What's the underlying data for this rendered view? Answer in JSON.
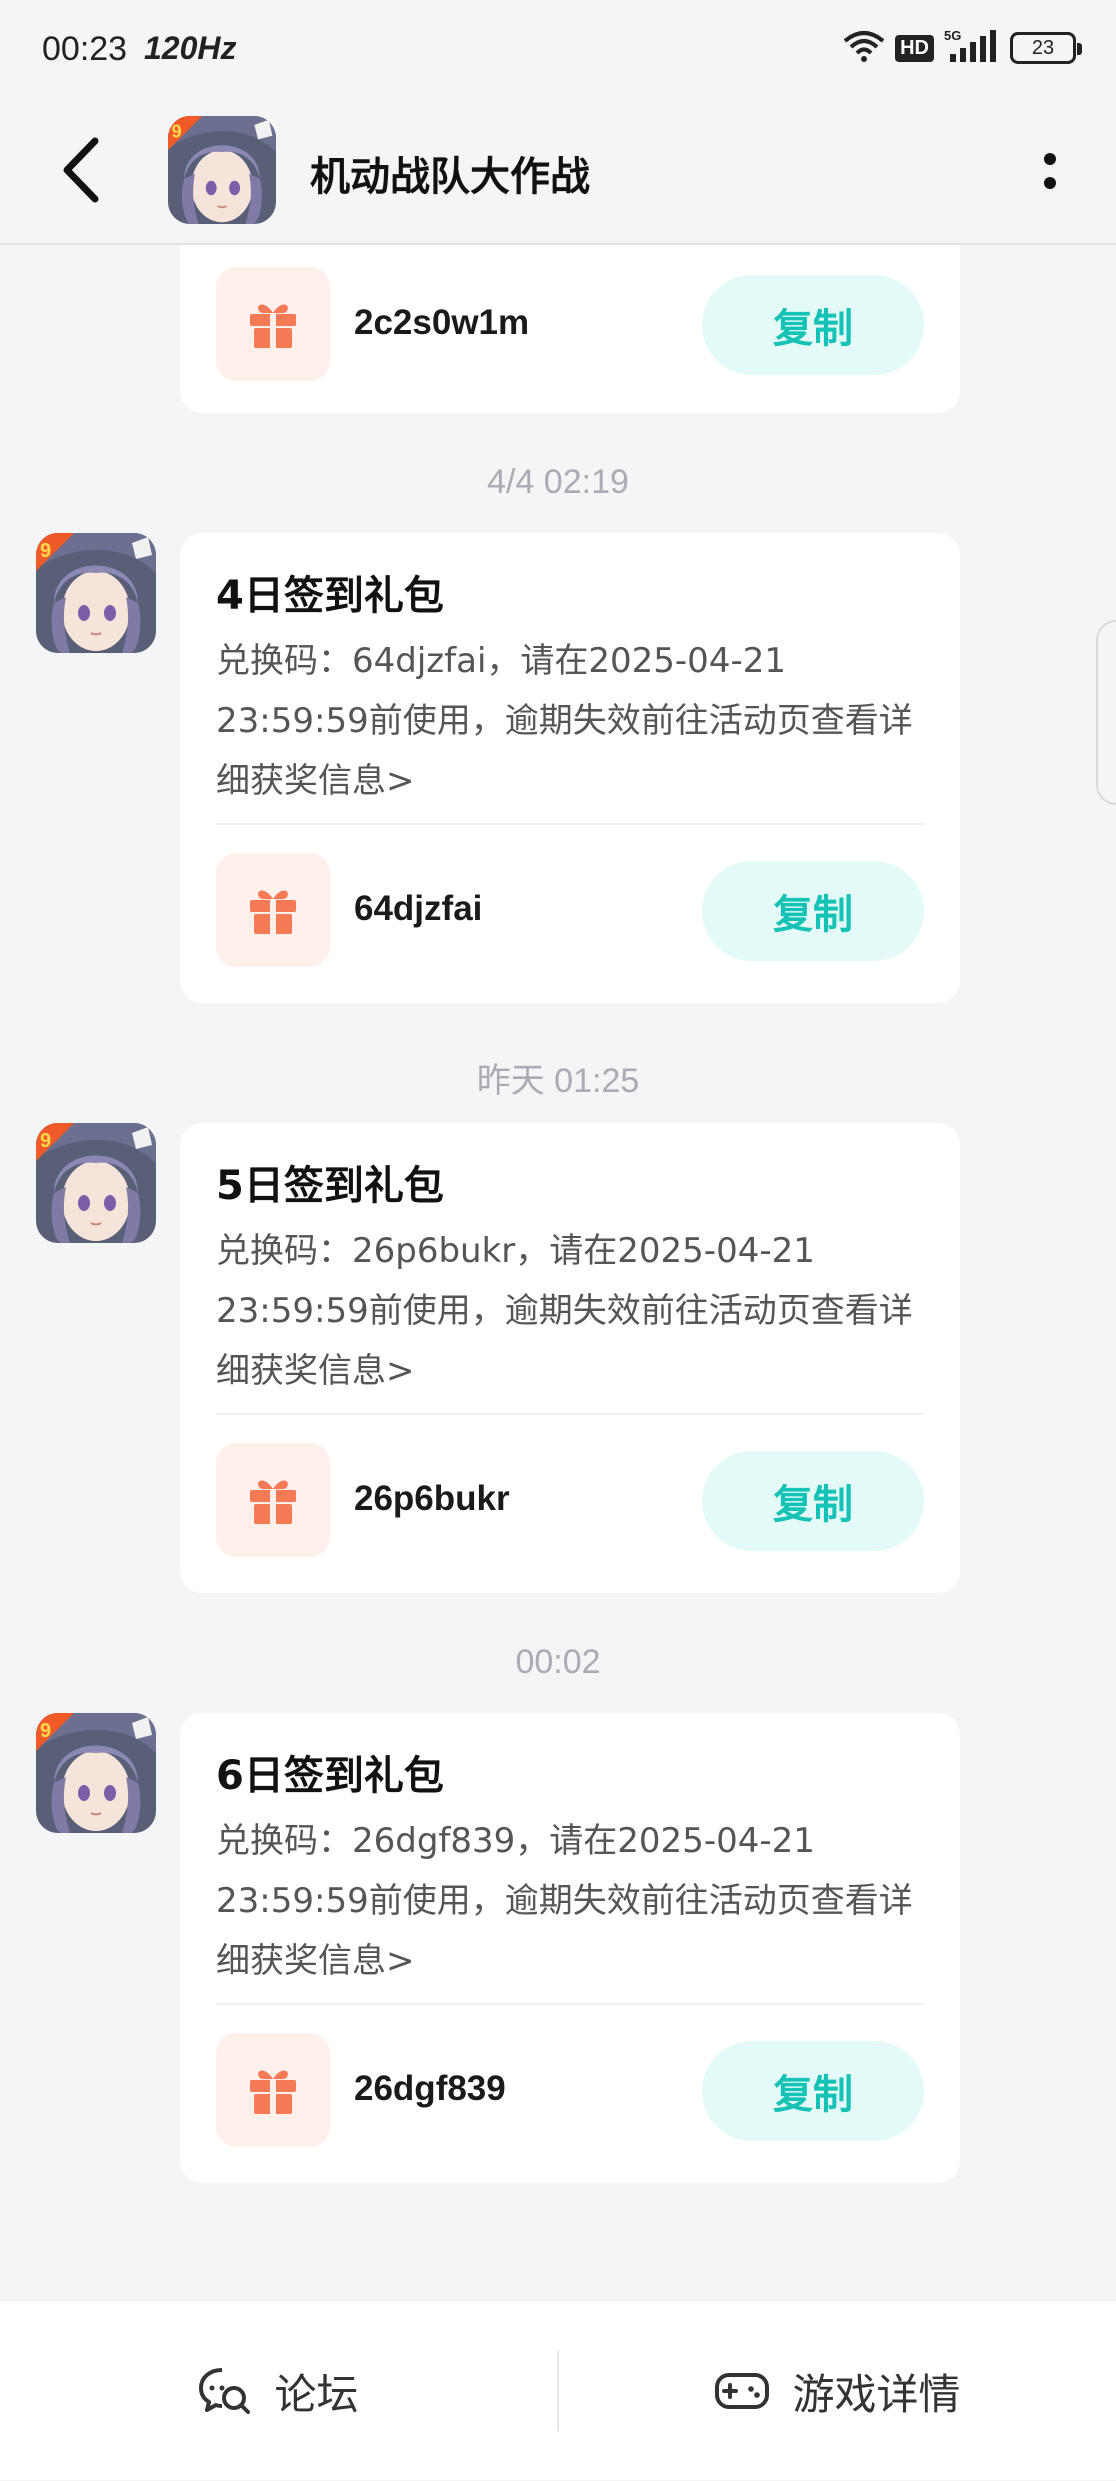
{
  "status_bar": {
    "time": "00:23",
    "refresh_rate": "120Hz",
    "hd": "HD",
    "network": "5G",
    "battery": "23"
  },
  "header": {
    "title": "机动战队大作战"
  },
  "messages": [
    {
      "code": "2c2s0w1m",
      "copy_label": "复制"
    },
    {
      "timestamp": "4/4  02:19",
      "title": "4日签到礼包",
      "description": "兑换码：64djzfai，请在2025-04-21 23:59:59前使用，逾期失效前往活动页查看详细获奖信息>",
      "code": "64djzfai",
      "copy_label": "复制"
    },
    {
      "timestamp": "昨天  01:25",
      "title": "5日签到礼包",
      "description": "兑换码：26p6bukr，请在2025-04-21 23:59:59前使用，逾期失效前往活动页查看详细获奖信息>",
      "code": "26p6bukr",
      "copy_label": "复制"
    },
    {
      "timestamp": "00:02",
      "title": "6日签到礼包",
      "description": "兑换码：26dgf839，请在2025-04-21 23:59:59前使用，逾期失效前往活动页查看详细获奖信息>",
      "code": "26dgf839",
      "copy_label": "复制"
    }
  ],
  "bottom_nav": {
    "forum_label": "论坛",
    "game_details_label": "游戏详情"
  },
  "colors": {
    "accent": "#14c3b6",
    "gift": "#f47a55",
    "copy_bg": "#e4faf8"
  }
}
